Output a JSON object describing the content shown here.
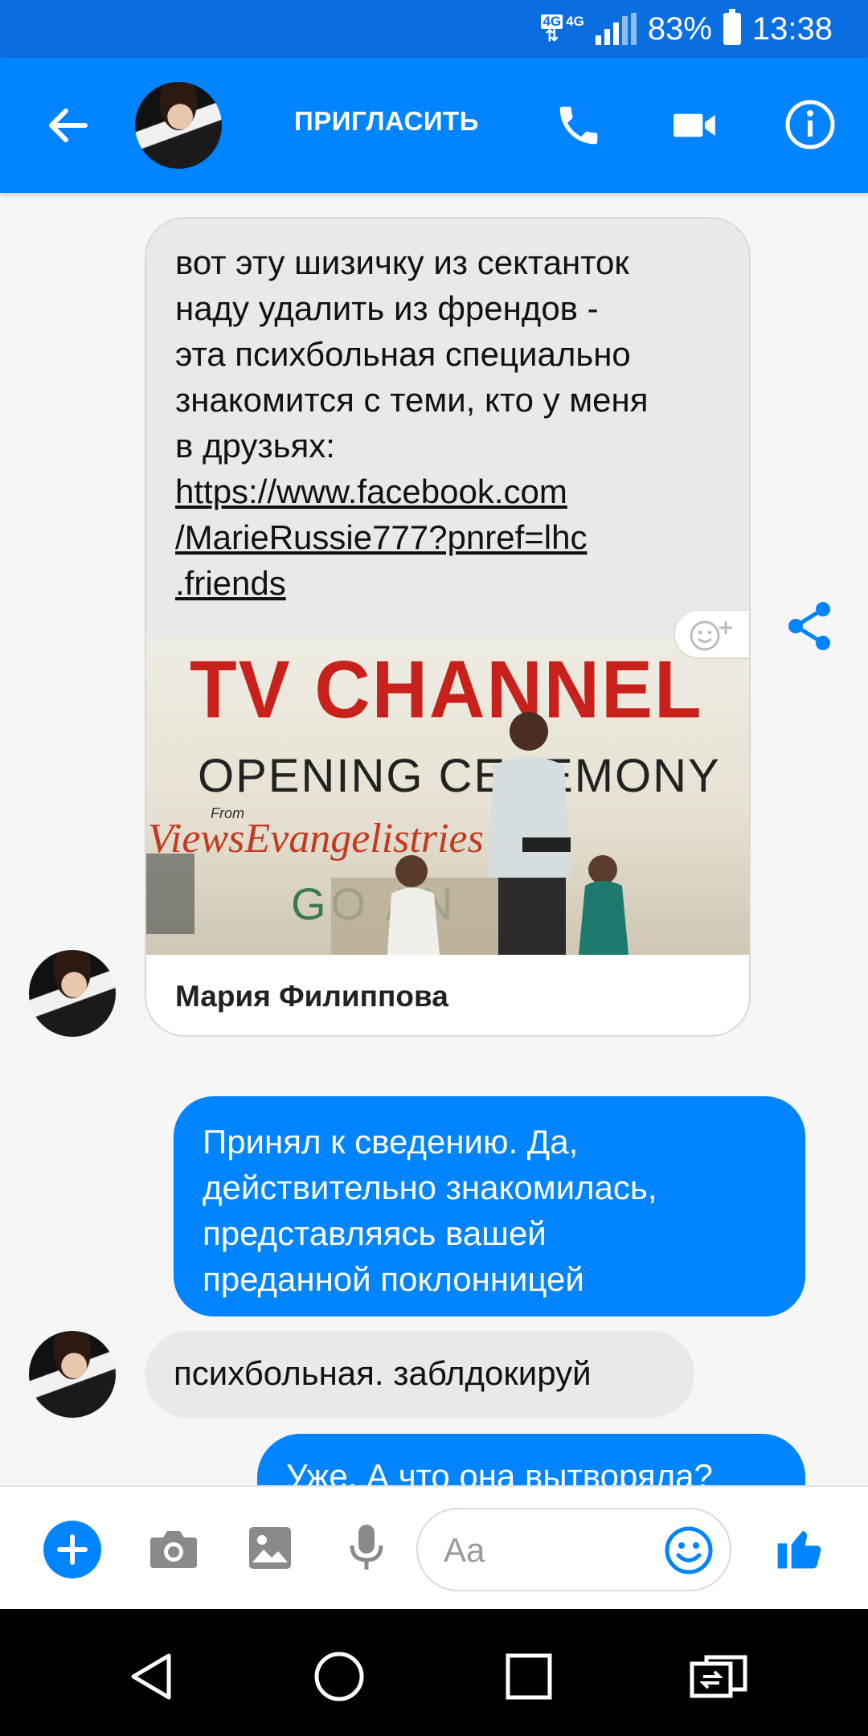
{
  "status_bar": {
    "network_label": "4G",
    "network_label_2": "4G",
    "battery": "83%",
    "time": "13:38",
    "battery_level": 0.83
  },
  "header": {
    "invite_label": "ПРИГЛАСИТЬ",
    "icons": [
      "back-arrow-icon",
      "phone-icon",
      "video-camera-icon",
      "info-icon"
    ]
  },
  "messages": [
    {
      "direction": "incoming",
      "lines": [
        "вот эту шизичку из сектанток",
        "наду удалить из френдов -",
        "эта психбольная специально",
        "знакомится с теми, кто у меня",
        "в друзьях:"
      ],
      "link_lines": [
        "https://www.facebook.com",
        "/MarieRussie777?pnref=lhc",
        ".friends"
      ],
      "preview": {
        "image_text_1": "TV CHANNEL",
        "image_text_2": "OPENING CEREMONY",
        "image_text_3": "From",
        "image_text_4": "ViewsEvangelistries",
        "image_text_5": "GO AN",
        "footer_name": "Мария Филиппова"
      }
    },
    {
      "direction": "outgoing",
      "lines": [
        "Принял к сведению. Да,",
        "действительно знакомилась,",
        "представляясь вашей",
        "преданной поклонницей"
      ]
    },
    {
      "direction": "incoming",
      "lines": [
        "психбольная. заблдокируй"
      ]
    },
    {
      "direction": "outgoing",
      "lines": [
        "Уже. А что она вытворяла?"
      ]
    }
  ],
  "composer": {
    "placeholder": "Aa",
    "icons": [
      "plus-icon",
      "camera-icon",
      "image-icon",
      "microphone-icon",
      "emoji-icon",
      "thumbs-up-icon"
    ]
  },
  "nav_bar": {
    "icons": [
      "back-triangle-icon",
      "home-circle-icon",
      "recents-square-icon",
      "switch-apps-icon"
    ]
  },
  "colors": {
    "status_bar": "#0a6ee0",
    "header": "#0084ff",
    "outgoing_bubble": "#0084ff",
    "incoming_bubble": "#e9e9e9"
  }
}
